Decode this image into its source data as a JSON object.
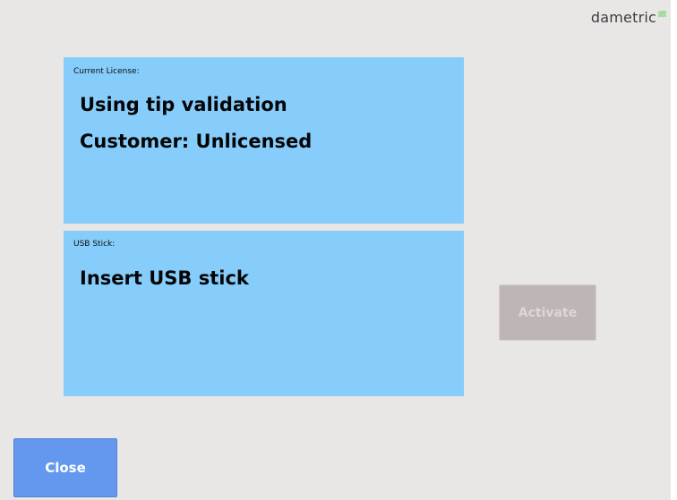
{
  "branding": {
    "logo_text": "dametric",
    "logo_mark_icon": "striped-square-icon"
  },
  "license_panel": {
    "caption": "Current License:",
    "line1": "Using tip validation",
    "line2": "Customer: Unlicensed"
  },
  "usb_panel": {
    "caption": "USB Stick:",
    "line1": "Insert USB stick"
  },
  "buttons": {
    "activate_label": "Activate",
    "activate_enabled": false,
    "close_label": "Close"
  },
  "colors": {
    "background": "#e9e6e6",
    "panel": "#86cdfc",
    "close_button": "#6498ee",
    "activate_disabled": "#bdb6b5"
  }
}
